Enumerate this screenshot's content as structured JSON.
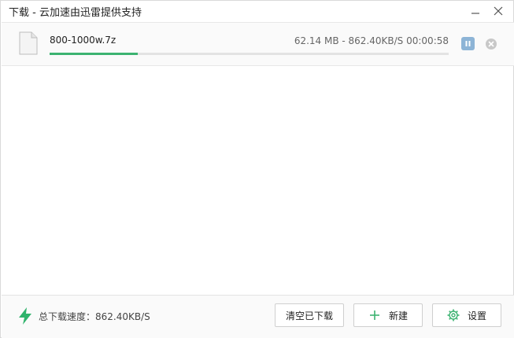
{
  "window": {
    "title": "下载 - 云加速由迅雷提供支持"
  },
  "download": {
    "file_name": "800-1000w.7z",
    "stats": "62.14 MB - 862.40KB/S 00:00:58",
    "progress_fraction": 0.22,
    "accent_color": "#3cb371"
  },
  "footer": {
    "speed_label": "总下载速度：862.40KB/S",
    "clear_label": "清空已下载",
    "new_label": "新建",
    "settings_label": "设置"
  },
  "icons": {
    "minimize": "minimize-icon",
    "close": "close-icon",
    "file": "file-icon",
    "pause": "pause-icon",
    "cancel": "cancel-circle-icon",
    "speed": "lightning-icon",
    "new": "plus-icon",
    "settings": "gear-icon"
  }
}
